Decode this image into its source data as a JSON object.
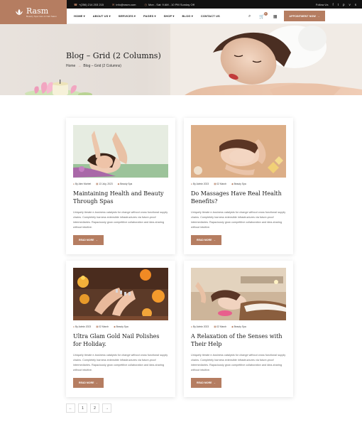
{
  "brand": {
    "name": "Rasm",
    "tagline": "Beauty Spa Care & Nail Salon",
    "accent": "#b57d61"
  },
  "topbar": {
    "phone": "+(256) 214 203 215",
    "email": "info@rasm.com",
    "hours": "Mon - Sat: 9 AM - 10 PM Sunday Off",
    "follow": "Follow Us"
  },
  "nav": {
    "items": [
      "HOME ▾",
      "ABOUT US ▾",
      "SERVICES ▾",
      "PAGES ▾",
      "SHOP ▾",
      "BLOG ▾",
      "CONTACT US"
    ],
    "cart_count": "0",
    "appointment": "APPOINTMENT NOW"
  },
  "hero": {
    "title": "Blog – Grid (2 Columns)",
    "breadcrumb_home": "Home",
    "breadcrumb_sep": "→",
    "breadcrumb_current": "Blog – Grid (2 Columns)"
  },
  "posts": [
    {
      "author": "By Alex Morbet",
      "date": "13 July, 2023",
      "category": "Beauty Spa",
      "title": "Maintaining Health and Beauty Through Spas",
      "excerpt": "Uniquely iterate e-business catalysts for change without cross functional supply chains. Completely harness extensible infrastructures via future-proof intermediaries. Rapaciously grow competitive collaboration and idea-sharing without intuitive.",
      "button": "READ MORE"
    },
    {
      "author": "By Admin 2023",
      "date": "02 March",
      "category": "Beauty Spa",
      "title": "Do Massages Have Real Health Benefits?",
      "excerpt": "Uniquely iterate e-business catalysts for change without cross functional supply chains. Completely harness extensible infrastructures via future-proof intermediaries. Rapaciously grow competitive collaboration and idea-sharing without intuitive.",
      "button": "READ MORE"
    },
    {
      "author": "By Admin 2023",
      "date": "02 March",
      "category": "Beauty Spa",
      "title": "Ultra Glam Gold Nail Polishes for Holiday.",
      "excerpt": "Uniquely iterate e-business catalysts for change without cross functional supply chains. Completely harness extensible infrastructures via future-proof intermediaries. Rapaciously grow competitive collaboration and idea-sharing without intuitive.",
      "button": "READ MORE"
    },
    {
      "author": "By Admin 2023",
      "date": "02 March",
      "category": "Beauty Spa",
      "title": "A Relaxation of the Senses with Their Help",
      "excerpt": "Uniquely iterate e-business catalysts for change without cross functional supply chains. Completely harness extensible infrastructures via future-proof intermediaries. Rapaciously grow competitive collaboration and idea-sharing without intuitive.",
      "button": "READ MORE"
    }
  ],
  "pagination": {
    "prev": "←",
    "pages": [
      "1",
      "2"
    ],
    "next": "→"
  }
}
